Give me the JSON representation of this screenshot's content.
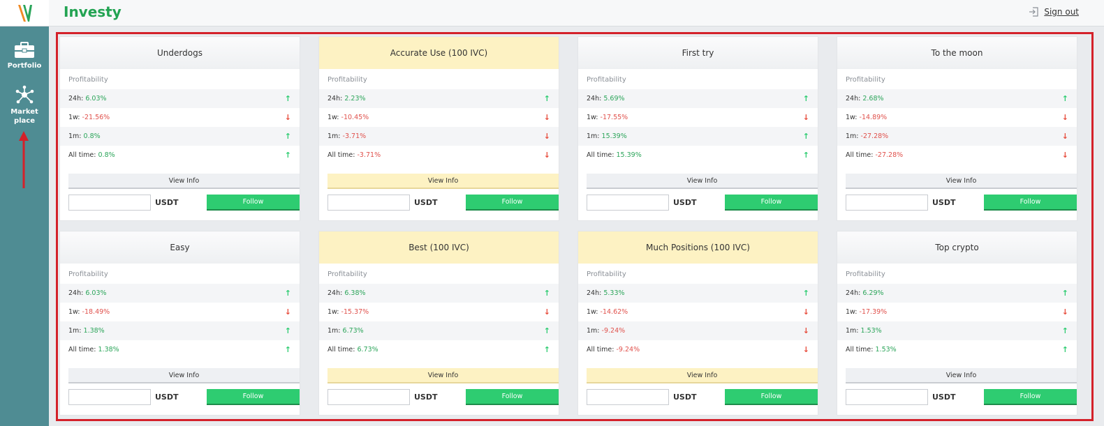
{
  "app": {
    "brand": "Investy",
    "signout_label": "Sign out"
  },
  "sidebar": {
    "items": [
      {
        "label": "Portfolio",
        "icon": "briefcase-icon"
      },
      {
        "label": "Market place",
        "icon": "network-icon"
      }
    ]
  },
  "colors": {
    "accent": "#22a352",
    "sidebar": "#4f8c93",
    "follow": "#2ecc71",
    "highlight": "#fdf2c3",
    "frame": "#d4212a"
  },
  "labels": {
    "profitability": "Profitability",
    "view_info": "View Info",
    "unit": "USDT",
    "follow": "Follow"
  },
  "cards": [
    {
      "title": "Underdogs",
      "gold": false,
      "rows": [
        {
          "label": "24h:",
          "value": "6.03%",
          "trend": "up"
        },
        {
          "label": "1w:",
          "value": "-21.56%",
          "trend": "down"
        },
        {
          "label": "1m:",
          "value": "0.8%",
          "trend": "up"
        },
        {
          "label": "All time:",
          "value": "0.8%",
          "trend": "up"
        }
      ]
    },
    {
      "title": "Accurate Use (100 IVC)",
      "gold": true,
      "rows": [
        {
          "label": "24h:",
          "value": "2.23%",
          "trend": "up"
        },
        {
          "label": "1w:",
          "value": "-10.45%",
          "trend": "down"
        },
        {
          "label": "1m:",
          "value": "-3.71%",
          "trend": "down"
        },
        {
          "label": "All time:",
          "value": "-3.71%",
          "trend": "down"
        }
      ]
    },
    {
      "title": "First try",
      "gold": false,
      "rows": [
        {
          "label": "24h:",
          "value": "5.69%",
          "trend": "up"
        },
        {
          "label": "1w:",
          "value": "-17.55%",
          "trend": "down"
        },
        {
          "label": "1m:",
          "value": "15.39%",
          "trend": "up"
        },
        {
          "label": "All time:",
          "value": "15.39%",
          "trend": "up"
        }
      ]
    },
    {
      "title": "To the moon",
      "gold": false,
      "rows": [
        {
          "label": "24h:",
          "value": "2.68%",
          "trend": "up"
        },
        {
          "label": "1w:",
          "value": "-14.89%",
          "trend": "down"
        },
        {
          "label": "1m:",
          "value": "-27.28%",
          "trend": "down"
        },
        {
          "label": "All time:",
          "value": "-27.28%",
          "trend": "down"
        }
      ]
    },
    {
      "title": "Easy",
      "gold": false,
      "rows": [
        {
          "label": "24h:",
          "value": "6.03%",
          "trend": "up"
        },
        {
          "label": "1w:",
          "value": "-18.49%",
          "trend": "down"
        },
        {
          "label": "1m:",
          "value": "1.38%",
          "trend": "up"
        },
        {
          "label": "All time:",
          "value": "1.38%",
          "trend": "up"
        }
      ]
    },
    {
      "title": "Best (100 IVC)",
      "gold": true,
      "rows": [
        {
          "label": "24h:",
          "value": "6.38%",
          "trend": "up"
        },
        {
          "label": "1w:",
          "value": "-15.37%",
          "trend": "down"
        },
        {
          "label": "1m:",
          "value": "6.73%",
          "trend": "up"
        },
        {
          "label": "All time:",
          "value": "6.73%",
          "trend": "up"
        }
      ]
    },
    {
      "title": "Much Positions (100 IVC)",
      "gold": true,
      "rows": [
        {
          "label": "24h:",
          "value": "5.33%",
          "trend": "up"
        },
        {
          "label": "1w:",
          "value": "-14.62%",
          "trend": "down"
        },
        {
          "label": "1m:",
          "value": "-9.24%",
          "trend": "down"
        },
        {
          "label": "All time:",
          "value": "-9.24%",
          "trend": "down"
        }
      ]
    },
    {
      "title": "Top crypto",
      "gold": false,
      "rows": [
        {
          "label": "24h:",
          "value": "6.29%",
          "trend": "up"
        },
        {
          "label": "1w:",
          "value": "-17.39%",
          "trend": "down"
        },
        {
          "label": "1m:",
          "value": "1.53%",
          "trend": "up"
        },
        {
          "label": "All time:",
          "value": "1.53%",
          "trend": "up"
        }
      ]
    }
  ]
}
